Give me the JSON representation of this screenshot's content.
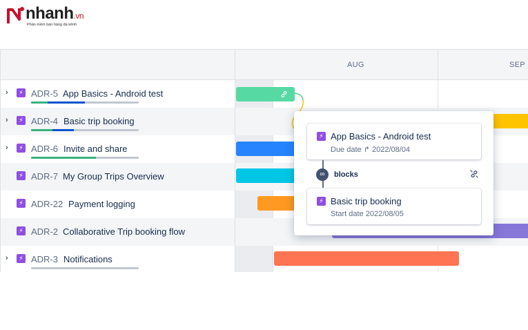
{
  "brand": {
    "name": "nhanh",
    "tld": ".vn",
    "tagline": "Phần mềm bán hàng đa kênh",
    "color": "#c8102e"
  },
  "timeline": {
    "months": [
      "AUG",
      "SEP"
    ]
  },
  "issues": [
    {
      "key": "ADR-5",
      "title": "App Basics - Android test",
      "has_children": true,
      "progress": {
        "done": 0.15,
        "in_progress": 0.36
      },
      "bar_color": "#57d9a3"
    },
    {
      "key": "ADR-4",
      "title": "Basic trip booking",
      "has_children": true,
      "progress": {
        "done": 0.2,
        "in_progress": 0.2
      },
      "bar_color": "#ffc400"
    },
    {
      "key": "ADR-6",
      "title": "Invite and share",
      "has_children": true,
      "progress": {
        "done": 0.6,
        "in_progress": 0.0
      },
      "bar_color": "#2684ff"
    },
    {
      "key": "ADR-7",
      "title": "My Group Trips Overview",
      "has_children": false,
      "progress": null,
      "bar_color": "#00c7e6"
    },
    {
      "key": "ADR-22",
      "title": "Payment logging",
      "has_children": false,
      "progress": null,
      "bar_color": "#ff991f"
    },
    {
      "key": "ADR-2",
      "title": "Collaborative Trip booking flow",
      "has_children": false,
      "progress": null,
      "bar_color": "#8777d9"
    },
    {
      "key": "ADR-3",
      "title": "Notifications",
      "has_children": true,
      "progress": {
        "done": 0.0,
        "in_progress": 0.0
      },
      "bar_color": "#ff7452"
    }
  ],
  "dependency_popup": {
    "source": {
      "title": "App Basics - Android test",
      "date_label": "Due date",
      "date": "2022/08/04"
    },
    "relation": "blocks",
    "target": {
      "title": "Basic trip booking",
      "date_label": "Start date",
      "date": "2022/08/05"
    }
  },
  "icons": {
    "epic": "lightning-icon",
    "expand": "chevron-right-icon",
    "link": "link-icon",
    "unlink": "unlink-icon"
  }
}
